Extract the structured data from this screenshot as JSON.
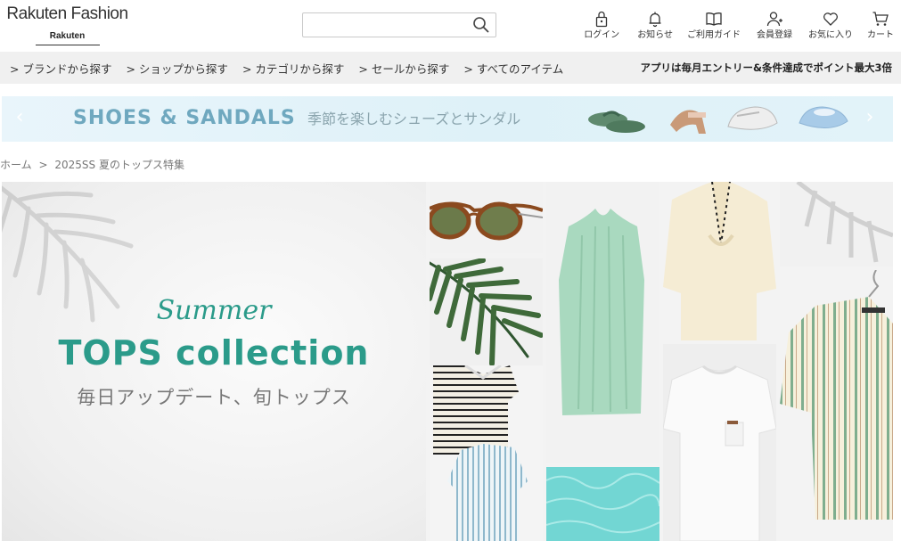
{
  "header": {
    "logo_main": "Rakuten Fashion",
    "logo_sub": "Rakuten",
    "search": {
      "value": "",
      "placeholder": ""
    },
    "nav": [
      {
        "label": "ログイン",
        "icon": "lock-icon"
      },
      {
        "label": "お知らせ",
        "icon": "bell-icon"
      },
      {
        "label": "ご利用ガイド",
        "icon": "book-icon"
      },
      {
        "label": "会員登録",
        "icon": "user-add-icon"
      },
      {
        "label": "お気に入り",
        "icon": "heart-icon"
      },
      {
        "label": "カート",
        "icon": "cart-icon"
      }
    ]
  },
  "category_bar": {
    "links": [
      "ブランドから探す",
      "ショップから探す",
      "カテゴリから探す",
      "セールから探す",
      "すべてのアイテム"
    ],
    "promo": "アプリは毎月エントリー&条件達成でポイント最大3倍"
  },
  "banner": {
    "title": "SHOES & SANDALS",
    "subtitle": "季節を楽しむシューズとサンダル",
    "prev_icon": "chevron-left-icon",
    "next_icon": "chevron-right-icon"
  },
  "breadcrumb": {
    "home": "ホーム",
    "separator": ">",
    "current": "2025SS 夏のトップス特集"
  },
  "hero": {
    "script_text": "Summer",
    "title": "TOPS collection",
    "subtitle": "毎日アップデート、旬トップス"
  },
  "colors": {
    "accent_teal": "#2b9b8a",
    "banner_blue": "#6fa8bf",
    "category_bar_bg": "#f0f0f0"
  }
}
